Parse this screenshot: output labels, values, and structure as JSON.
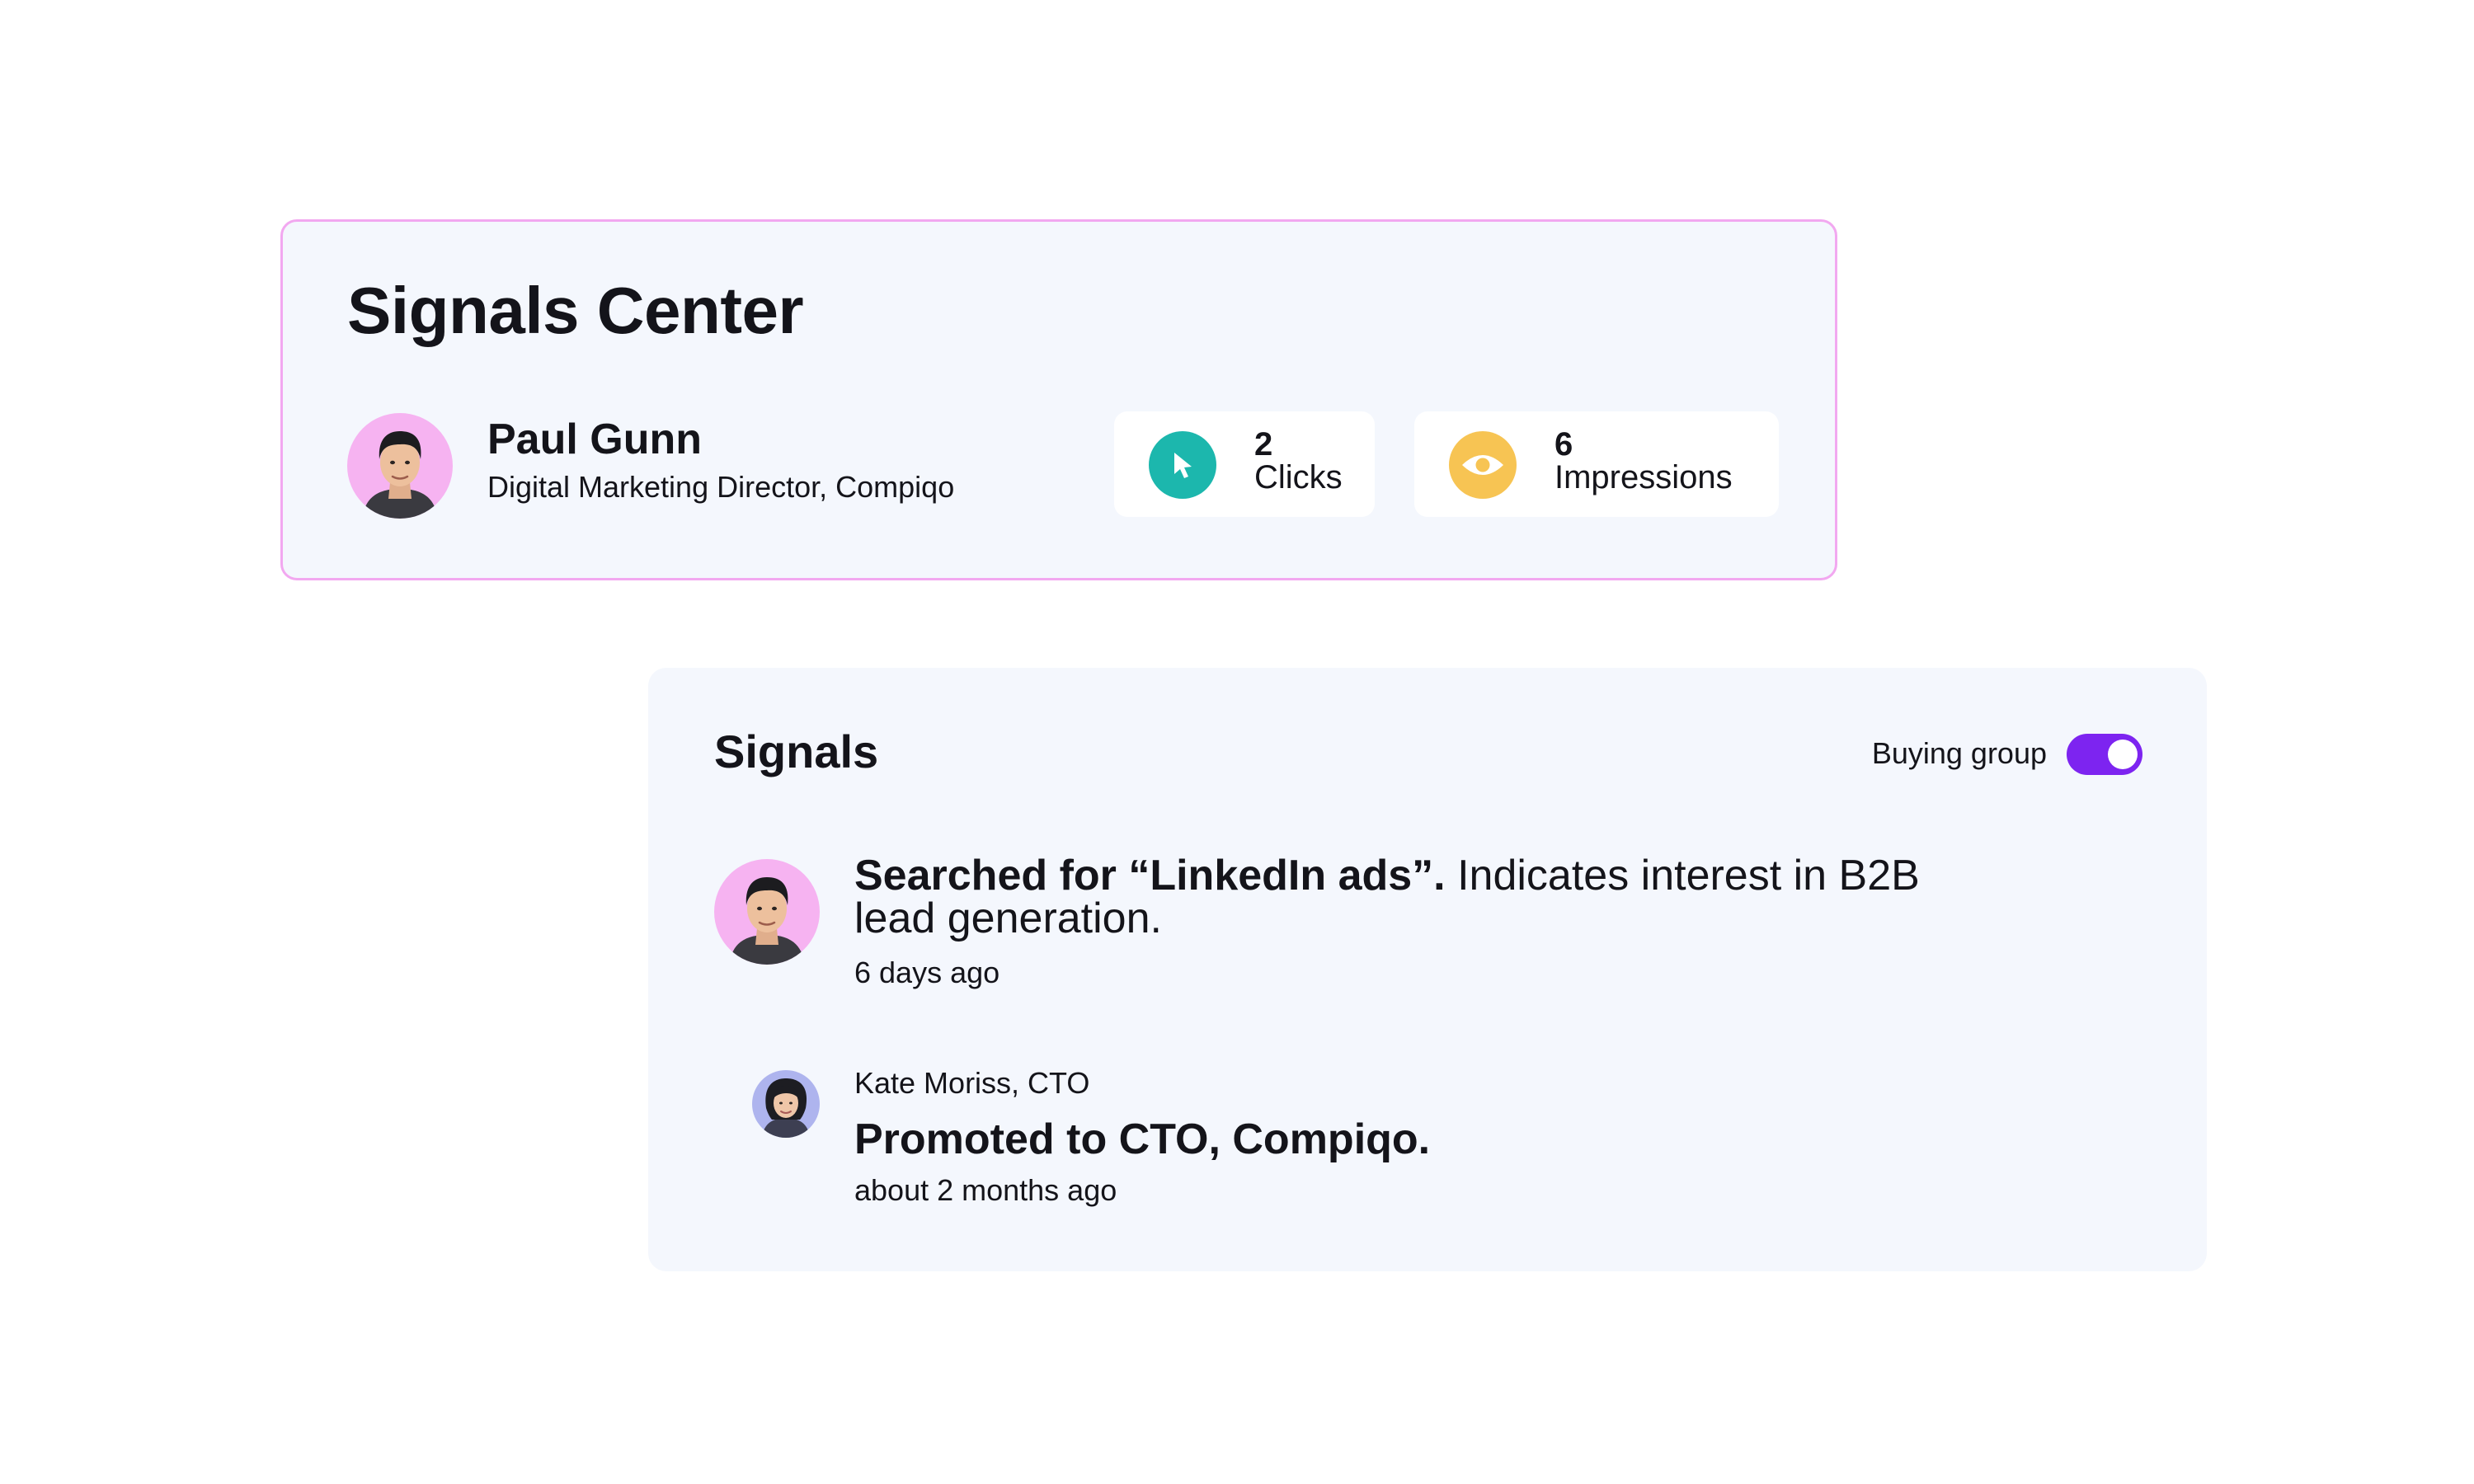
{
  "signals_center": {
    "title": "Signals Center",
    "profile": {
      "name": "Paul Gunn",
      "role": "Digital Marketing Director, Compiqo",
      "avatar_icon": "person-avatar-icon"
    },
    "stats": [
      {
        "value": "2",
        "label": "Clicks",
        "icon": "cursor-icon",
        "color": "#1cb7ad"
      },
      {
        "value": "6",
        "label": "Impressions",
        "icon": "eye-icon",
        "color": "#f7c453"
      }
    ],
    "border_color": "#f2a8f0"
  },
  "signals": {
    "title": "Signals",
    "buying_group_label": "Buying group",
    "buying_group_on": true,
    "toggle_color": "#7d24f0",
    "items": [
      {
        "highlight": "Searched for “LinkedIn ads”.",
        "text": " Indicates interest in B2B lead generation.",
        "time": "6 days ago",
        "avatar_icon": "person-avatar-icon"
      },
      {
        "who": "Kate Moriss, CTO",
        "text": "Promoted to CTO, Compiqo.",
        "time": "about 2 months ago",
        "avatar_icon": "person-avatar-icon"
      }
    ]
  }
}
